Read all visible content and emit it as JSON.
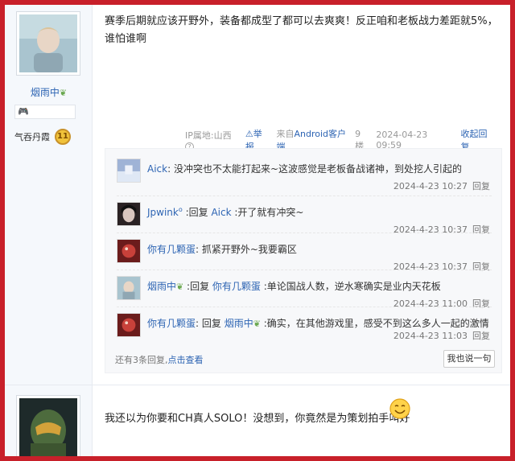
{
  "post1": {
    "username": "烟雨中",
    "medal_label": "气吞丹霞",
    "medal_level": "11",
    "content": "赛季后期就应该开野外，装备都成型了都可以去爽爽！反正咱和老板战力差距就5%，谁怕谁啊",
    "meta": {
      "ip": "IP属地:山西",
      "report": "举报",
      "client_prefix": "来自",
      "client": "Android客户端",
      "floor": "9楼",
      "datetime": "2024-04-23 09:59",
      "collapse": "收起回复"
    },
    "replies": [
      {
        "name": "Aick",
        "sep": ": ",
        "reply_word": "",
        "reply_to": "",
        "text": "没冲突也不太能打起来~这波感觉是老板备战诸神，到处挖人引起的",
        "time": "2024-4-23 10:27",
        "reply_label": "回复"
      },
      {
        "name": "Jpwink",
        "sep": " :",
        "reply_word": "回复 ",
        "reply_to": "Aick",
        "text": " :开了就有冲突~",
        "time": "2024-4-23 10:37",
        "reply_label": "回复"
      },
      {
        "name": "你有几颗蛋",
        "sep": ": ",
        "reply_word": "",
        "reply_to": "",
        "text": "抓紧开野外~我要霸区",
        "time": "2024-4-23 10:37",
        "reply_label": "回复"
      },
      {
        "name": "烟雨中",
        "sep": " :",
        "reply_word": "回复 ",
        "reply_to": "你有几颗蛋",
        "text": " :单论国战人数，逆水寒确实是业内天花板",
        "time": "2024-4-23 11:00",
        "reply_label": "回复"
      },
      {
        "name": "你有几颗蛋",
        "sep": ": ",
        "reply_word": "回复 ",
        "reply_to": "烟雨中",
        "text": " :确实，在其他游戏里，感受不到这么多人一起的激情",
        "time": "2024-4-23 11:03",
        "reply_label": "回复"
      }
    ],
    "more_text": "还有3条回复,",
    "more_link": "点击查看",
    "say_button": "我也说一句"
  },
  "post2": {
    "content": "我还以为你要和CH真人SOLO！没想到，你竟然是为策划拍手叫好"
  },
  "colors": {
    "frame": "#c8202a",
    "link": "#2d64b3",
    "reply_bg": "#f7f8fa"
  }
}
